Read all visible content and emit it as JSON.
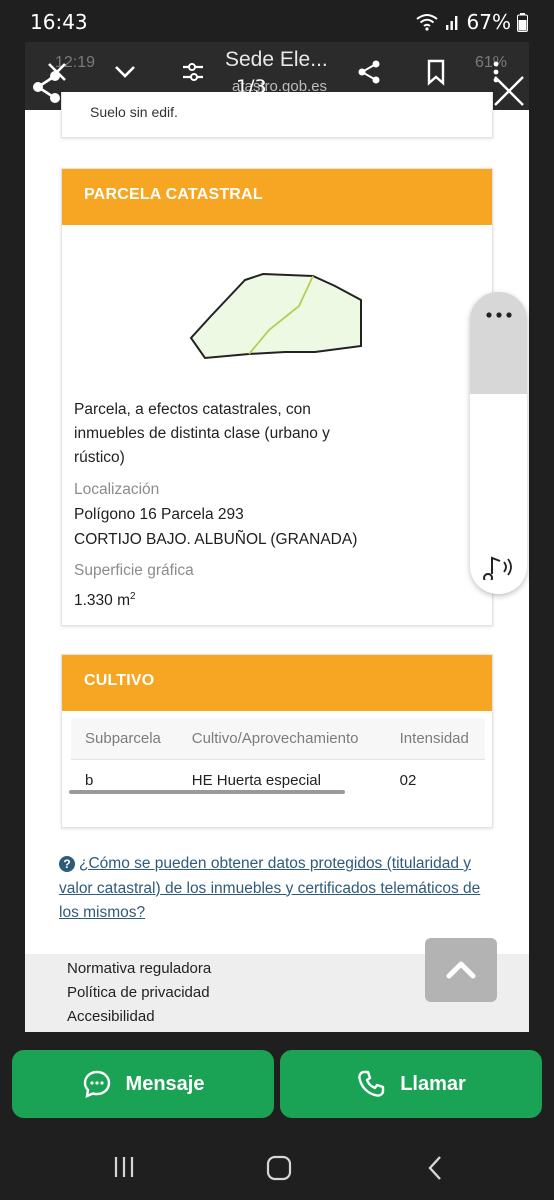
{
  "status_bar": {
    "time": "16:43",
    "battery": "67%",
    "icons": [
      "wifi-icon",
      "signal-icon",
      "battery-icon"
    ]
  },
  "viewer": {
    "page_counter": "1/3",
    "icons": [
      "share-icon",
      "close-icon"
    ]
  },
  "browser": {
    "title": "Sede Ele...",
    "domain": "atastro.gob.es",
    "ghost_left": "12:19",
    "ghost_right": "61%",
    "icons": [
      "close-icon",
      "chevron-down-icon",
      "tune-icon",
      "share-icon",
      "bookmark-icon",
      "more-vert-icon"
    ]
  },
  "page": {
    "prev_card_tail": "Suelo sin edif.",
    "parcela": {
      "header": "PARCELA CATASTRAL",
      "description": "Parcela, a efectos catastrales, con inmuebles de distinta clase (urbano y rústico)",
      "localizacion_label": "Localización",
      "localizacion_line1": "Polígono 16 Parcela 293",
      "localizacion_line2": "CORTIJO BAJO. ALBUÑOL (GRANADA)",
      "superficie_label": "Superficie gráfica",
      "superficie_value": "1.330 m",
      "superficie_unit_sup": "2"
    },
    "cultivo": {
      "header": "CULTIVO",
      "columns": [
        "Subparcela",
        "Cultivo/Aprovechamiento",
        "Intensidad"
      ],
      "rows": [
        [
          "b",
          "HE Huerta especial",
          "02"
        ]
      ]
    },
    "help_link": "¿Cómo se pueden obtener datos protegidos (titularidad y valor catastral) de los inmuebles y certificados telemáticos de los mismos?",
    "footer_links": [
      "Normativa reguladora",
      "Política de privacidad",
      "Accesibilidad"
    ]
  },
  "side_panel": {
    "icons": [
      "more-horiz-icon",
      "read-aloud-icon"
    ]
  },
  "actions": {
    "message_label": "Mensaje",
    "call_label": "Llamar"
  },
  "colors": {
    "accent_orange": "#f6a623",
    "action_green": "#1aa354",
    "link_blue": "#2e5b7a"
  }
}
